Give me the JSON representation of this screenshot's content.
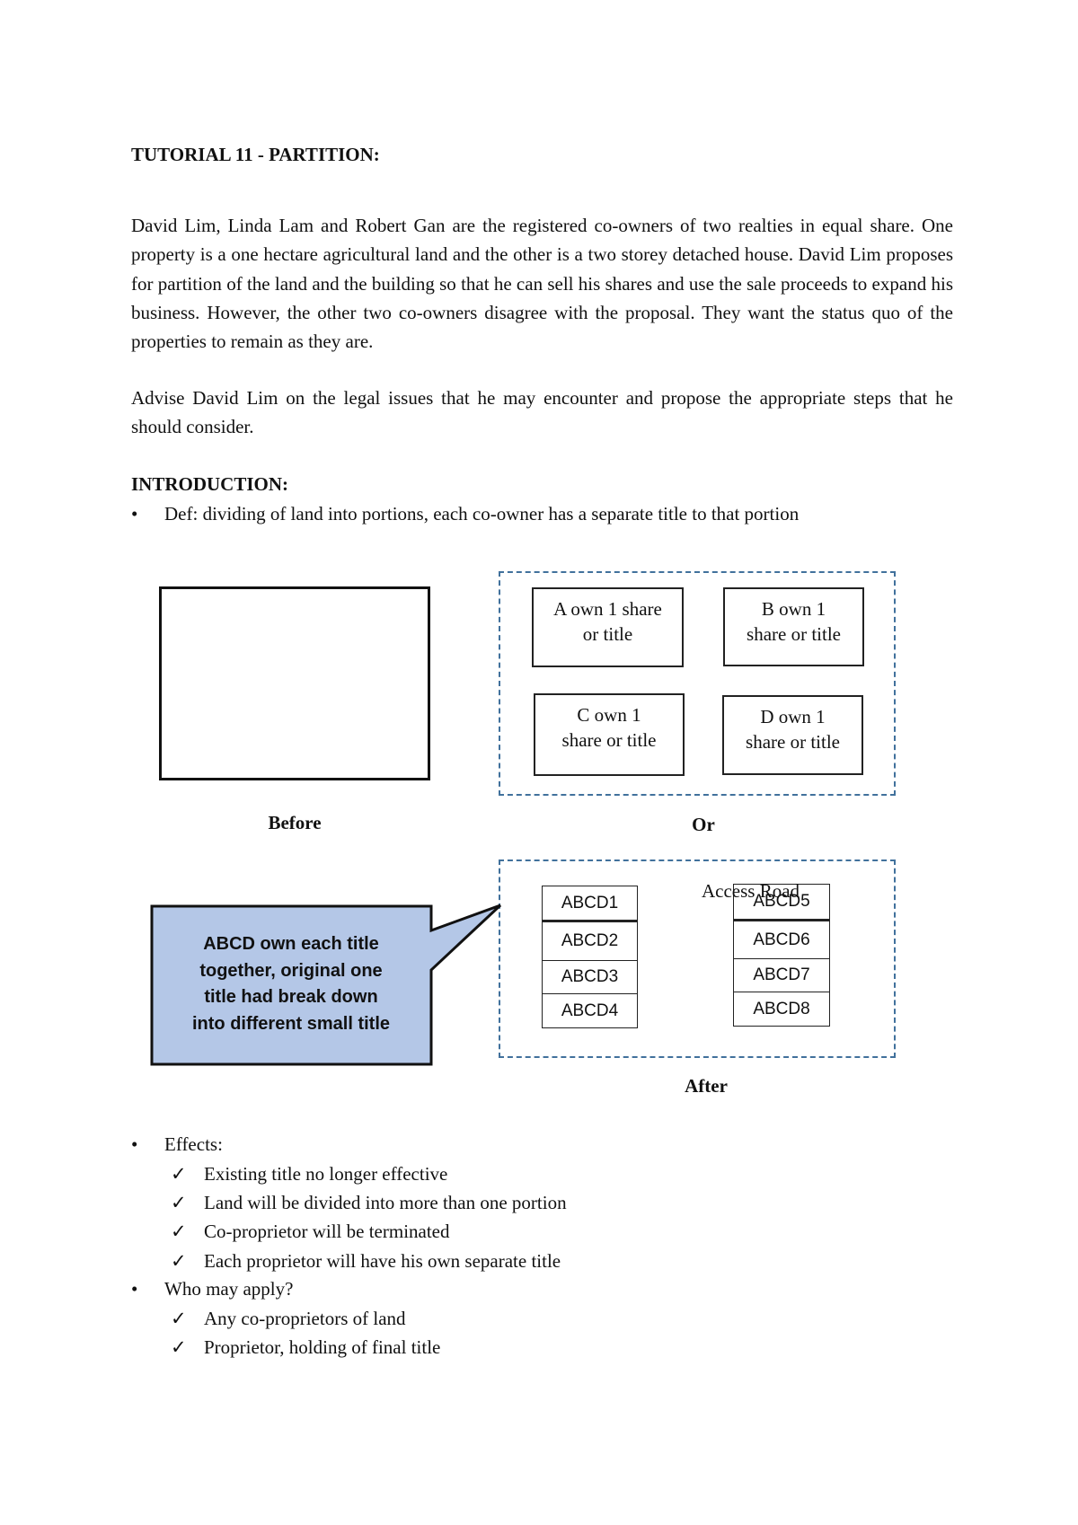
{
  "title": "TUTORIAL 11 - PARTITION:",
  "paragraphs": [
    "David Lim, Linda Lam and Robert Gan are the registered co-owners of two realties in equal share. One property is a one hectare agricultural land and the other is a two storey detached house. David Lim proposes for partition of the land and the building so that he can sell his shares and use the sale proceeds to expand his business. However, the other two co-owners disagree with the proposal. They want the status quo of the properties to remain as they are.",
    "Advise David Lim on the legal issues that he may encounter and propose the appropriate steps that he should consider."
  ],
  "introduction": {
    "heading": "INTRODUCTION:",
    "def": "Def: dividing of land into portions, each co-owner has a separate title to that portion"
  },
  "diagram": {
    "before_label": "Before",
    "or_label": "Or",
    "after_label": "After",
    "shares": [
      {
        "line1": "A own 1 share",
        "line2": "or title"
      },
      {
        "line1": "B own 1",
        "line2": "share or title"
      },
      {
        "line1": "C own 1",
        "line2": "share or title"
      },
      {
        "line1": "D own 1",
        "line2": "share or title"
      }
    ],
    "callout": [
      "ABCD own each title",
      "together, original one",
      "title had break down",
      "into different small title"
    ],
    "access_road": "Access Road",
    "lots_left": [
      "ABCD1",
      "ABCD2",
      "ABCD3",
      "ABCD4"
    ],
    "lots_right": [
      "ABCD5",
      "ABCD6",
      "ABCD7",
      "ABCD8"
    ],
    "colors": {
      "dash": "#41719c",
      "callout_fill": "#b4c7e7"
    }
  },
  "effects": {
    "label": "Effects:",
    "items": [
      "Existing title no longer effective",
      "Land will be divided into more than one portion",
      "Co-proprietor will be terminated",
      "Each proprietor will have his own separate title"
    ]
  },
  "who": {
    "label": "Who may apply?",
    "items": [
      "Any co-proprietors of land",
      "Proprietor, holding of final title"
    ]
  }
}
